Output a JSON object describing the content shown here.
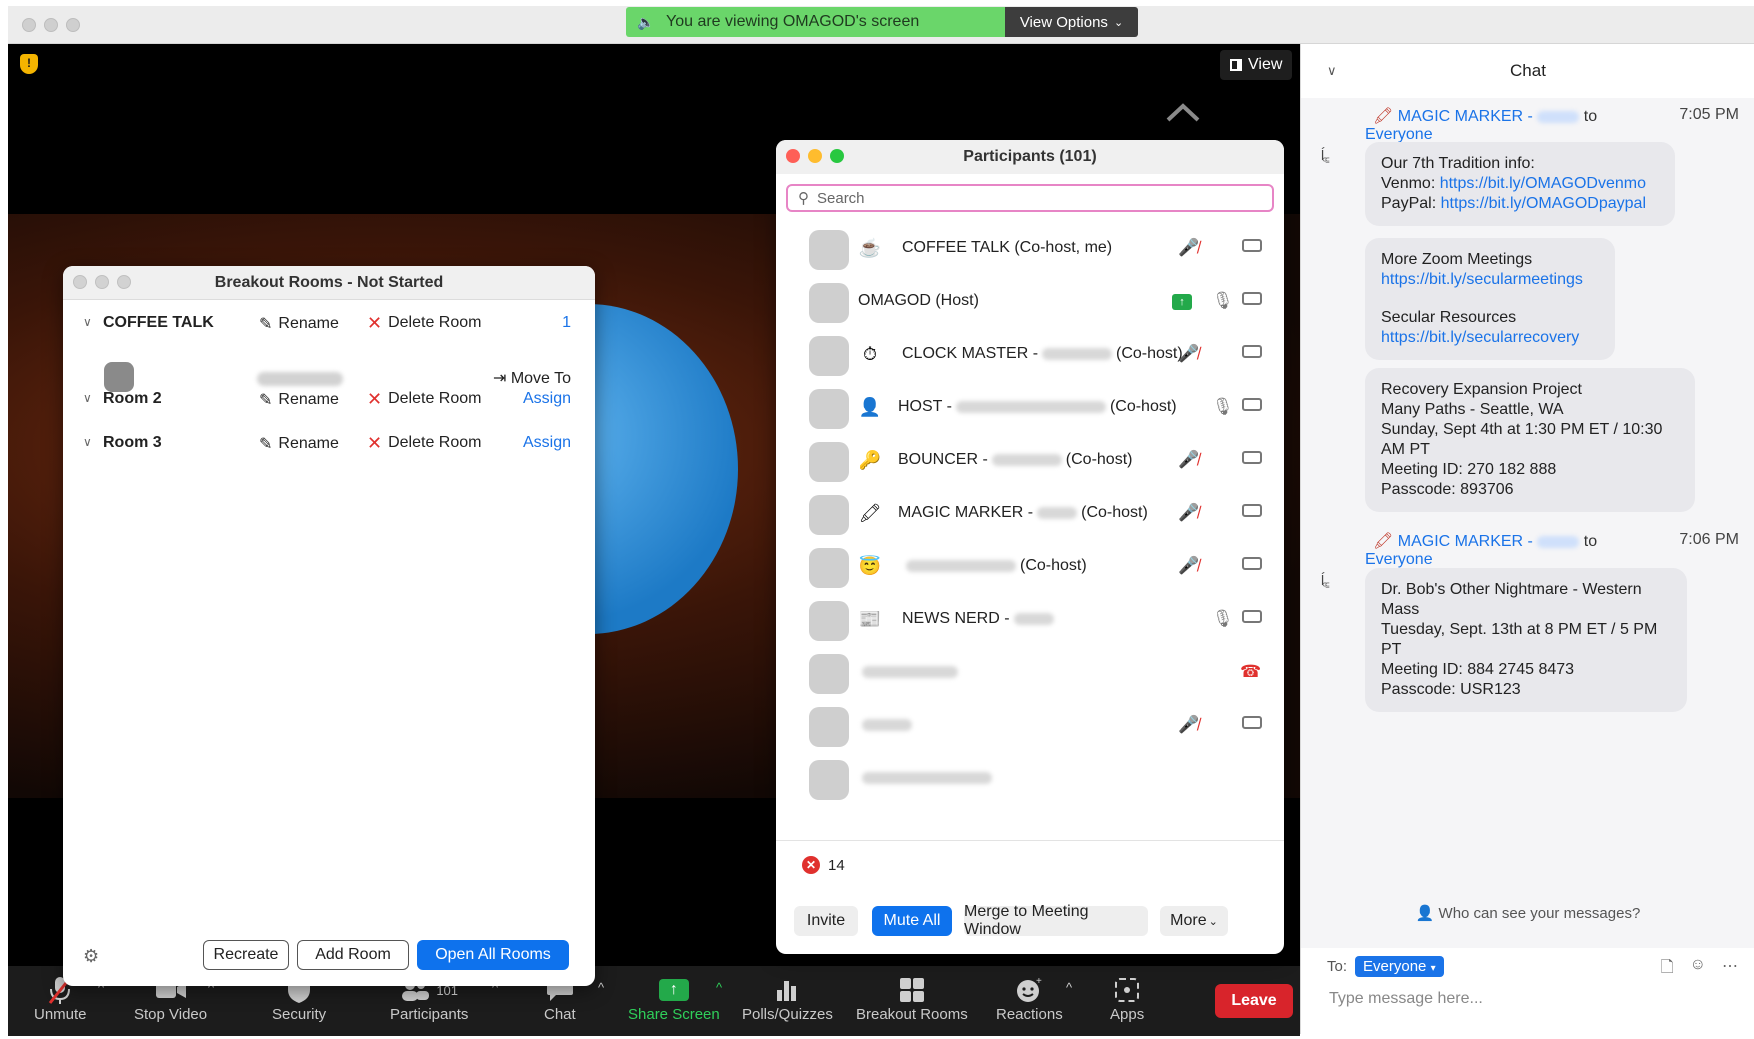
{
  "banner": {
    "viewing_text": "You are viewing OMAGOD's screen",
    "view_options": "View Options"
  },
  "video": {
    "view_label": "View"
  },
  "toolbar": {
    "unmute": "Unmute",
    "stop_video": "Stop Video",
    "security": "Security",
    "participants": "Participants",
    "participants_count": "101",
    "chat": "Chat",
    "share_screen": "Share Screen",
    "polls": "Polls/Quizzes",
    "breakout": "Breakout Rooms",
    "reactions": "Reactions",
    "apps": "Apps",
    "leave": "Leave"
  },
  "breakout": {
    "title": "Breakout Rooms - Not Started",
    "rooms": [
      {
        "name": "COFFEE TALK",
        "rename": "Rename",
        "delete": "Delete Room",
        "action": "1"
      },
      {
        "name": "Room 2",
        "rename": "Rename",
        "delete": "Delete Room",
        "action": "Assign"
      },
      {
        "name": "Room 3",
        "rename": "Rename",
        "delete": "Delete Room",
        "action": "Assign"
      }
    ],
    "member_move": "Move To",
    "recreate": "Recreate",
    "add_room": "Add Room",
    "open_all": "Open All Rooms"
  },
  "participants": {
    "title": "Participants (101)",
    "search_placeholder": "Search",
    "rows": [
      {
        "emoji": "☕",
        "pre": "COFFEE TALK (Co-host, me)",
        "post": ""
      },
      {
        "emoji": "",
        "pre": "OMAGOD (Host)",
        "post": ""
      },
      {
        "emoji": "⏱",
        "pre": "CLOCK MASTER -",
        "post": "(Co-host)"
      },
      {
        "emoji": "👤",
        "pre": "HOST -",
        "post": "(Co-host)"
      },
      {
        "emoji": "🔑",
        "pre": "BOUNCER -",
        "post": "(Co-host)"
      },
      {
        "emoji": "🖍",
        "pre": "MAGIC MARKER -",
        "post": "(Co-host)"
      },
      {
        "emoji": "😇",
        "pre": "",
        "post": "(Co-host)"
      },
      {
        "emoji": "📰",
        "pre": "NEWS NERD -",
        "post": ""
      }
    ],
    "not_joined_count": "14",
    "invite": "Invite",
    "mute_all": "Mute All",
    "merge": "Merge to Meeting Window",
    "more": "More"
  },
  "chat": {
    "title": "Chat",
    "messages": [
      {
        "sender": "MAGIC MARKER -",
        "to": "to",
        "recipient": "Everyone",
        "time": "7:05 PM",
        "bubbles": [
          {
            "l1": "Our 7th Tradition info:",
            "l2a": "Venmo: ",
            "l2b": "https://bit.ly/OMAGODvenmo",
            "l3a": "PayPal: ",
            "l3b": "https://bit.ly/OMAGODpaypal"
          },
          {
            "l1": "More Zoom Meetings",
            "l2": "https://bit.ly/secularmeetings",
            "l3": "Secular Resources",
            "l4": "https://bit.ly/secularrecovery"
          },
          {
            "l1": "Recovery Expansion Project",
            "l2": "Many Paths - Seattle, WA",
            "l3": "Sunday, Sept 4th at 1:30 PM ET / 10:30",
            "l4": "AM PT",
            "l5": "Meeting ID: 270 182 888",
            "l6": "Passcode: 893706"
          }
        ]
      },
      {
        "sender": "MAGIC MARKER -",
        "to": "to",
        "recipient": "Everyone",
        "time": "7:06 PM",
        "bubbles": [
          {
            "l1": "Dr. Bob's Other Nightmare - Western",
            "l2": "Mass",
            "l3": "Tuesday, Sept. 13th at 8 PM ET / 5 PM",
            "l4": "PT",
            "l5": "Meeting ID: 884 2745 8473",
            "l6": "Passcode: USR123"
          }
        ]
      }
    ],
    "who_can_see": "Who can see your messages?",
    "to_label": "To:",
    "to_value": "Everyone",
    "input_placeholder": "Type message here..."
  }
}
